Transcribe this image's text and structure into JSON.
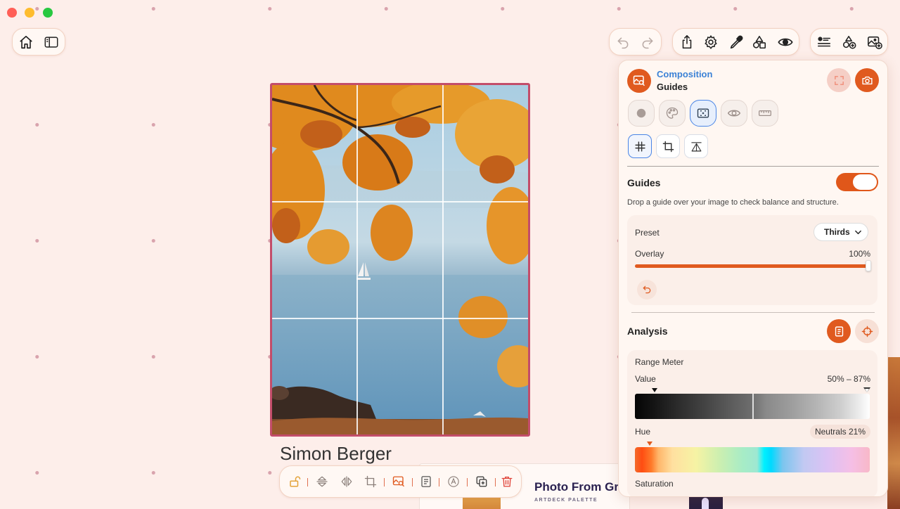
{
  "window": {
    "traffic_lights": [
      "close",
      "minimize",
      "zoom"
    ]
  },
  "top_left": {
    "icons": [
      "home-icon",
      "sidebar-icon"
    ]
  },
  "top_right": {
    "history_icons": [
      "undo-icon",
      "redo-icon"
    ],
    "tools_icons": [
      "share-icon",
      "gear-icon",
      "eyedropper-icon",
      "shapes-icon",
      "eye-icon"
    ],
    "extra_icons": [
      "list-icon",
      "add-shape-icon",
      "add-image-icon"
    ]
  },
  "canvas": {
    "photo_alt": "autumn lake photo",
    "caption": "Simon Berger",
    "grid": "thirds"
  },
  "behind_card": {
    "title": "Photo From Gr",
    "subtitle": "ARTDECK PALETTE"
  },
  "bottom_toolbar": {
    "icons": [
      "lock-icon",
      "flip-vertical-icon",
      "flip-horizontal-icon",
      "crop-icon",
      "image-search-icon",
      "note-icon",
      "text-style-icon",
      "duplicate-icon",
      "trash-icon"
    ]
  },
  "panel": {
    "title": "Composition",
    "subtitle": "Guides",
    "mode_tabs": [
      "circle-icon",
      "palette-icon",
      "focus-frame-icon",
      "eye-icon",
      "ruler-icon"
    ],
    "sub_tabs": [
      "grid-icon",
      "crop-icon",
      "perspective-icon"
    ],
    "guides": {
      "label": "Guides",
      "enabled": true,
      "description": "Drop a guide over your image to check balance and structure.",
      "preset_label": "Preset",
      "preset_value": "Thirds",
      "overlay_label": "Overlay",
      "overlay_value": "100%",
      "overlay_level": 1.0
    },
    "analysis": {
      "label": "Analysis",
      "range_meter_label": "Range Meter",
      "value_label": "Value",
      "value_range": "50% – 87%",
      "hue_label": "Hue",
      "hue_chip": "Neutrals 21%",
      "saturation_label": "Saturation"
    }
  },
  "colors": {
    "accent": "#e05a1f",
    "selection_blue": "#4a85e6",
    "photo_border": "#c34d6a",
    "background": "#fdeeea"
  }
}
